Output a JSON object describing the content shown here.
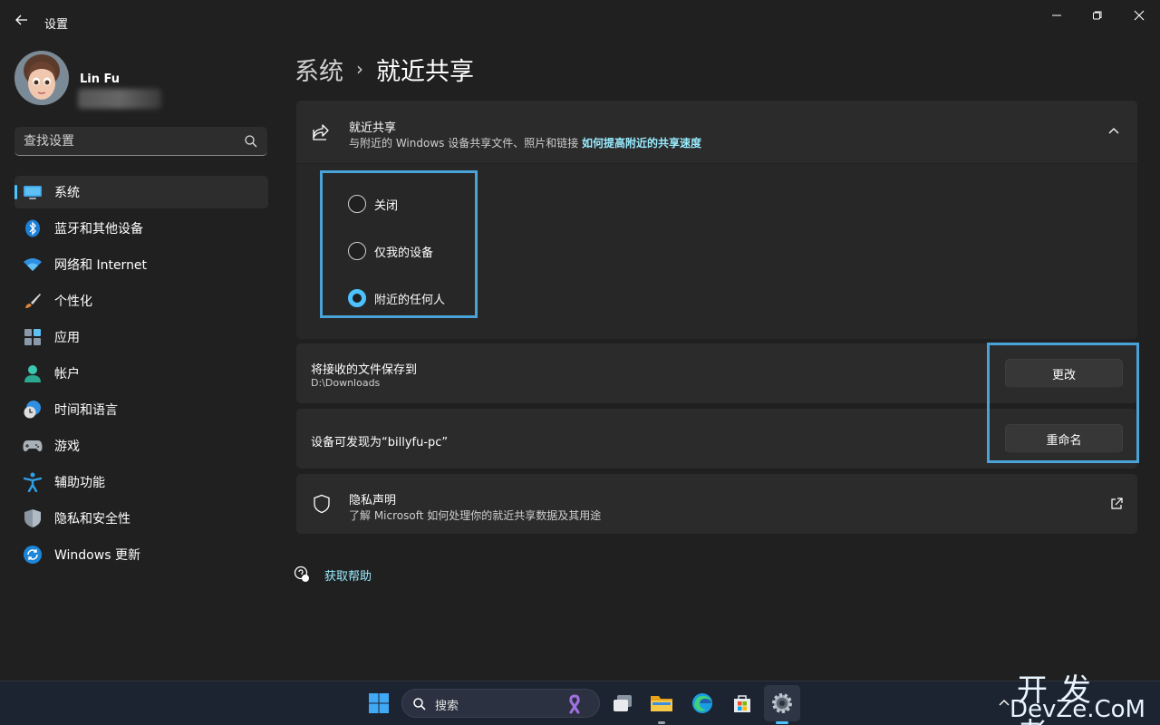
{
  "window": {
    "app_title": "设置"
  },
  "user": {
    "name": "Lin Fu"
  },
  "search": {
    "placeholder": "查找设置"
  },
  "sidebar": {
    "items": [
      {
        "label": "系统",
        "icon": "monitor-icon",
        "active": true
      },
      {
        "label": "蓝牙和其他设备",
        "icon": "bluetooth-icon",
        "active": false
      },
      {
        "label": "网络和 Internet",
        "icon": "wifi-icon",
        "active": false
      },
      {
        "label": "个性化",
        "icon": "brush-icon",
        "active": false
      },
      {
        "label": "应用",
        "icon": "apps-icon",
        "active": false
      },
      {
        "label": "帐户",
        "icon": "person-icon",
        "active": false
      },
      {
        "label": "时间和语言",
        "icon": "clock-globe-icon",
        "active": false
      },
      {
        "label": "游戏",
        "icon": "gamepad-icon",
        "active": false
      },
      {
        "label": "辅助功能",
        "icon": "accessibility-icon",
        "active": false
      },
      {
        "label": "隐私和安全性",
        "icon": "shield-icon",
        "active": false
      },
      {
        "label": "Windows 更新",
        "icon": "update-icon",
        "active": false
      }
    ]
  },
  "breadcrumb": {
    "parent": "系统",
    "separator": "›",
    "current": "就近共享"
  },
  "nearby_sharing": {
    "title": "就近共享",
    "subtitle": "与附近的 Windows 设备共享文件、照片和链接",
    "link": "如何提高附近的共享速度",
    "options": [
      {
        "label": "关闭",
        "checked": false
      },
      {
        "label": "仅我的设备",
        "checked": false
      },
      {
        "label": "附近的任何人",
        "checked": true
      }
    ]
  },
  "save_location": {
    "title": "将接收的文件保存到",
    "path": "D:\\Downloads",
    "button": "更改"
  },
  "discoverable": {
    "title": "设备可发现为“billyfu-pc”",
    "button": "重命名"
  },
  "privacy": {
    "title": "隐私声明",
    "subtitle": "了解 Microsoft 如何处理你的就近共享数据及其用途"
  },
  "help": {
    "label": "获取帮助"
  },
  "taskbar": {
    "search_label": "搜索"
  },
  "watermark": {
    "top": "开发者",
    "bottom": "DevZe.CoM"
  },
  "colors": {
    "accent": "#4cc2ff",
    "link": "#99ebff",
    "highlight_frame": "#4aa3d8",
    "background": "#202020",
    "card": "#2b2b2b"
  }
}
